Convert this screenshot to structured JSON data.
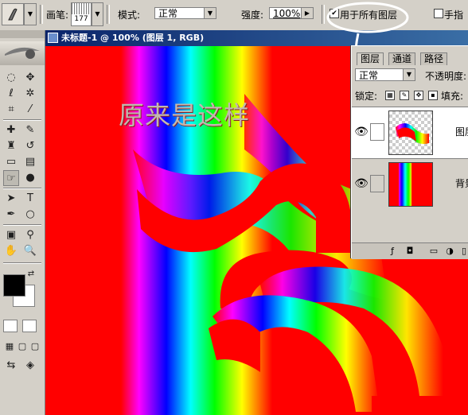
{
  "options_bar": {
    "brush_label": "画笔:",
    "brush_size": "177",
    "mode_label": "模式:",
    "mode_value": "正常",
    "strength_label": "强度:",
    "strength_value": "100%",
    "use_all_layers_label": "用于所有图层",
    "use_all_layers_checked": "✔",
    "finger_painting_label": "手指"
  },
  "document": {
    "title": "未标题-1 @ 100% (图层 1, RGB)",
    "canvas_text": "原来是这样"
  },
  "layers_panel": {
    "tabs": [
      "图层",
      "通道",
      "路径"
    ],
    "blend_mode": "正常",
    "opacity_label": "不透明度:",
    "lock_label": "锁定:",
    "fill_label": "填充:",
    "layers": [
      {
        "name": "图层"
      },
      {
        "name": "背景"
      }
    ]
  },
  "colors": {
    "foreground": "#000000",
    "background": "#ffffff",
    "canvas_base": "#ff0000"
  }
}
